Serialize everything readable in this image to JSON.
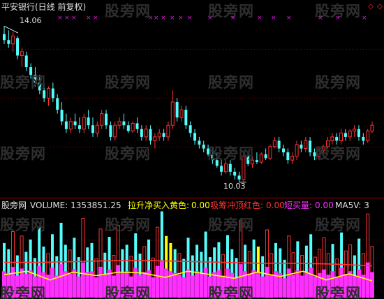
{
  "header": {
    "title": "平安银行(日线 前复权)",
    "max_label": "14.06",
    "min_label": "10.03"
  },
  "indicator": {
    "name_label": "股旁网",
    "volume_label": "VOLUME: 1353851.25",
    "item1_label": "拉升净买入黄色:",
    "item1_value": "0.00",
    "item2_label": "吸筹冲顶红色:",
    "item2_value": "0.00",
    "item3_label": "短买量:",
    "item3_value": "0.00",
    "item4_label": "MA5V: 3"
  },
  "top_marks": {
    "glyph": "×",
    "corner_glyph": "◇",
    "corner_glyph2": "◇"
  },
  "watermarks": {
    "text": "股旁网"
  },
  "colors": {
    "up": "#ff3232",
    "down": "#54fcfc",
    "yellow_bar": "#ffff00",
    "magenta": "#ff30ff",
    "red_line": "#ff3232",
    "yellow_line": "#ffff00",
    "grid": "#a00000",
    "title_text": "#e0e0e0",
    "volume_text": "#e0e0e0",
    "item1_text": "#ffff00",
    "item2_text": "#ff3232",
    "item3_text": "#ff30ff",
    "item4_text": "#e0e0e0"
  },
  "chart_data": [
    {
      "type": "candlestick",
      "title": "平安银行(日线 前复权)",
      "max_value": 14.06,
      "min_value": 10.03,
      "ylim": [
        9.9,
        14.3
      ],
      "ohlc": [
        [
          13.85,
          14.06,
          13.6,
          13.7
        ],
        [
          13.7,
          13.95,
          13.5,
          13.6
        ],
        [
          13.6,
          13.9,
          13.4,
          13.8
        ],
        [
          13.75,
          13.8,
          13.2,
          13.3
        ],
        [
          13.3,
          13.5,
          13.0,
          13.4
        ],
        [
          13.3,
          13.4,
          12.9,
          13.0
        ],
        [
          13.0,
          13.1,
          12.7,
          12.8
        ],
        [
          12.8,
          13.0,
          12.5,
          12.6
        ],
        [
          12.6,
          12.8,
          12.3,
          12.4
        ],
        [
          12.4,
          12.6,
          12.1,
          12.2
        ],
        [
          12.2,
          12.5,
          12.0,
          12.45
        ],
        [
          12.45,
          12.6,
          12.1,
          12.2
        ],
        [
          12.2,
          12.3,
          11.8,
          11.9
        ],
        [
          11.9,
          12.1,
          11.5,
          11.6
        ],
        [
          11.6,
          11.8,
          11.3,
          11.4
        ],
        [
          11.4,
          11.7,
          11.3,
          11.6
        ],
        [
          11.6,
          11.8,
          11.4,
          11.5
        ],
        [
          11.5,
          11.7,
          11.3,
          11.4
        ],
        [
          11.4,
          11.8,
          11.3,
          11.7
        ],
        [
          11.7,
          11.9,
          11.4,
          11.5
        ],
        [
          11.5,
          11.7,
          11.2,
          11.3
        ],
        [
          11.3,
          11.6,
          11.2,
          11.5
        ],
        [
          11.5,
          11.9,
          11.4,
          11.8
        ],
        [
          11.8,
          11.9,
          11.4,
          11.5
        ],
        [
          11.5,
          11.6,
          11.1,
          11.2
        ],
        [
          11.2,
          11.6,
          11.1,
          11.5
        ],
        [
          11.5,
          11.7,
          11.4,
          11.6
        ],
        [
          11.6,
          11.8,
          11.4,
          11.5
        ],
        [
          11.5,
          11.6,
          11.3,
          11.35
        ],
        [
          11.35,
          11.6,
          11.3,
          11.55
        ],
        [
          11.55,
          11.7,
          11.3,
          11.4
        ],
        [
          11.4,
          11.5,
          11.1,
          11.2
        ],
        [
          11.2,
          11.5,
          11.1,
          11.4
        ],
        [
          11.4,
          11.5,
          11.0,
          11.1
        ],
        [
          11.1,
          11.3,
          10.9,
          11.2
        ],
        [
          11.2,
          11.4,
          11.1,
          11.3
        ],
        [
          11.3,
          11.4,
          11.1,
          11.2
        ],
        [
          11.2,
          11.6,
          11.1,
          11.5
        ],
        [
          11.5,
          12.4,
          11.4,
          12.1
        ],
        [
          12.1,
          12.2,
          11.6,
          11.7
        ],
        [
          11.7,
          12.0,
          11.6,
          11.9
        ],
        [
          11.9,
          12.0,
          11.4,
          11.5
        ],
        [
          11.5,
          11.6,
          11.2,
          11.3
        ],
        [
          11.3,
          11.4,
          11.0,
          11.1
        ],
        [
          11.1,
          11.2,
          10.9,
          11.0
        ],
        [
          11.0,
          11.1,
          10.8,
          10.9
        ],
        [
          10.9,
          11.0,
          10.7,
          10.75
        ],
        [
          10.75,
          10.9,
          10.5,
          10.6
        ],
        [
          10.6,
          10.8,
          10.4,
          10.45
        ],
        [
          10.45,
          10.6,
          10.2,
          10.3
        ],
        [
          10.3,
          10.6,
          10.25,
          10.5
        ],
        [
          10.5,
          10.6,
          10.2,
          10.3
        ],
        [
          10.3,
          10.4,
          10.1,
          10.2
        ],
        [
          10.2,
          10.3,
          10.03,
          10.1
        ],
        [
          10.1,
          10.8,
          10.05,
          10.7
        ],
        [
          10.7,
          10.8,
          10.45,
          10.5
        ],
        [
          10.5,
          10.7,
          10.4,
          10.6
        ],
        [
          10.6,
          10.8,
          10.5,
          10.55
        ],
        [
          10.55,
          10.8,
          10.5,
          10.75
        ],
        [
          10.75,
          10.9,
          10.6,
          10.65
        ],
        [
          10.65,
          11.0,
          10.6,
          10.95
        ],
        [
          10.95,
          11.2,
          10.9,
          11.1
        ],
        [
          11.1,
          11.2,
          10.8,
          10.9
        ],
        [
          10.9,
          11.0,
          10.7,
          10.8
        ],
        [
          10.8,
          10.9,
          10.5,
          10.6
        ],
        [
          10.6,
          10.8,
          10.5,
          10.7
        ],
        [
          10.7,
          11.1,
          10.6,
          11.0
        ],
        [
          11.0,
          11.1,
          10.8,
          10.9
        ],
        [
          10.9,
          11.2,
          10.8,
          11.1
        ],
        [
          11.1,
          11.2,
          10.7,
          10.8
        ],
        [
          10.8,
          10.9,
          10.6,
          10.7
        ],
        [
          10.7,
          10.9,
          10.6,
          10.85
        ],
        [
          10.85,
          11.0,
          10.7,
          10.95
        ],
        [
          10.95,
          11.2,
          10.9,
          11.1
        ],
        [
          11.1,
          11.3,
          11.0,
          11.2
        ],
        [
          11.2,
          11.3,
          11.0,
          11.1
        ],
        [
          11.1,
          11.4,
          11.0,
          11.3
        ],
        [
          11.3,
          11.4,
          11.1,
          11.2
        ],
        [
          11.2,
          11.4,
          11.1,
          11.35
        ],
        [
          11.35,
          11.5,
          11.2,
          11.4
        ],
        [
          11.4,
          11.5,
          11.1,
          11.2
        ],
        [
          11.2,
          11.3,
          11.0,
          11.1
        ],
        [
          11.1,
          11.4,
          11.05,
          11.35
        ],
        [
          11.35,
          11.6,
          11.3,
          11.5
        ]
      ]
    },
    {
      "type": "bar",
      "title": "VOLUME",
      "series": [
        {
          "name": "VOLUME",
          "values": [
            0.62,
            0.55,
            0.75,
            0.48,
            0.7,
            0.52,
            0.66,
            0.45,
            0.8,
            0.58,
            0.5,
            0.72,
            0.47,
            0.85,
            0.6,
            0.54,
            0.68,
            0.46,
            0.9,
            0.57,
            0.62,
            0.44,
            0.78,
            0.51,
            0.69,
            0.48,
            0.82,
            0.55,
            0.6,
            0.47,
            0.73,
            0.5,
            0.58,
            0.66,
            0.45,
            0.8,
            0.98,
            0.7,
            0.62,
            0.55,
            0.5,
            0.44,
            0.68,
            0.48,
            0.6,
            0.52,
            0.75,
            0.46,
            0.57,
            0.63,
            0.49,
            0.71,
            0.55,
            0.45,
            0.88,
            0.6,
            0.52,
            0.66,
            0.58,
            0.47,
            0.77,
            0.5,
            0.62,
            0.56,
            0.43,
            0.7,
            0.51,
            0.64,
            0.48,
            0.59,
            0.72,
            0.46,
            0.55,
            0.68,
            0.5,
            0.61,
            0.44,
            0.74,
            0.53,
            0.6,
            0.48,
            0.67,
            0.5,
            0.95,
            0.58
          ]
        },
        {
          "name": "短买量",
          "values": [
            0.3,
            0.28,
            0.35,
            0.25,
            0.33,
            0.27,
            0.31,
            0.24,
            0.36,
            0.29,
            0.26,
            0.34,
            0.25,
            0.38,
            0.3,
            0.27,
            0.32,
            0.24,
            0.4,
            0.29,
            0.3,
            0.23,
            0.35,
            0.26,
            0.32,
            0.25,
            0.37,
            0.28,
            0.3,
            0.24,
            0.34,
            0.26,
            0.29,
            0.31,
            0.23,
            0.36,
            0.42,
            0.33,
            0.3,
            0.28,
            0.26,
            0.23,
            0.32,
            0.25,
            0.3,
            0.27,
            0.34,
            0.24,
            0.29,
            0.31,
            0.25,
            0.33,
            0.28,
            0.23,
            0.38,
            0.3,
            0.27,
            0.31,
            0.29,
            0.24,
            0.35,
            0.26,
            0.3,
            0.28,
            0.22,
            0.33,
            0.26,
            0.31,
            0.25,
            0.29,
            0.34,
            0.24,
            0.28,
            0.32,
            0.26,
            0.3,
            0.23,
            0.34,
            0.27,
            0.3,
            0.25,
            0.32,
            0.26,
            0.4,
            0.29
          ]
        }
      ],
      "yellow_bars_at": [
        37,
        38,
        58
      ],
      "ma_red": [
        0.4,
        0.4,
        0.41,
        0.42,
        0.42,
        0.41,
        0.4,
        0.39,
        0.39,
        0.38,
        0.36
      ],
      "ma_yellow": [
        0.26,
        0.3,
        0.2,
        0.29,
        0.25,
        0.29,
        0.28,
        0.23,
        0.3,
        0.26,
        0.22,
        0.29,
        0.24,
        0.3,
        0.2,
        0.27,
        0.19
      ]
    }
  ]
}
